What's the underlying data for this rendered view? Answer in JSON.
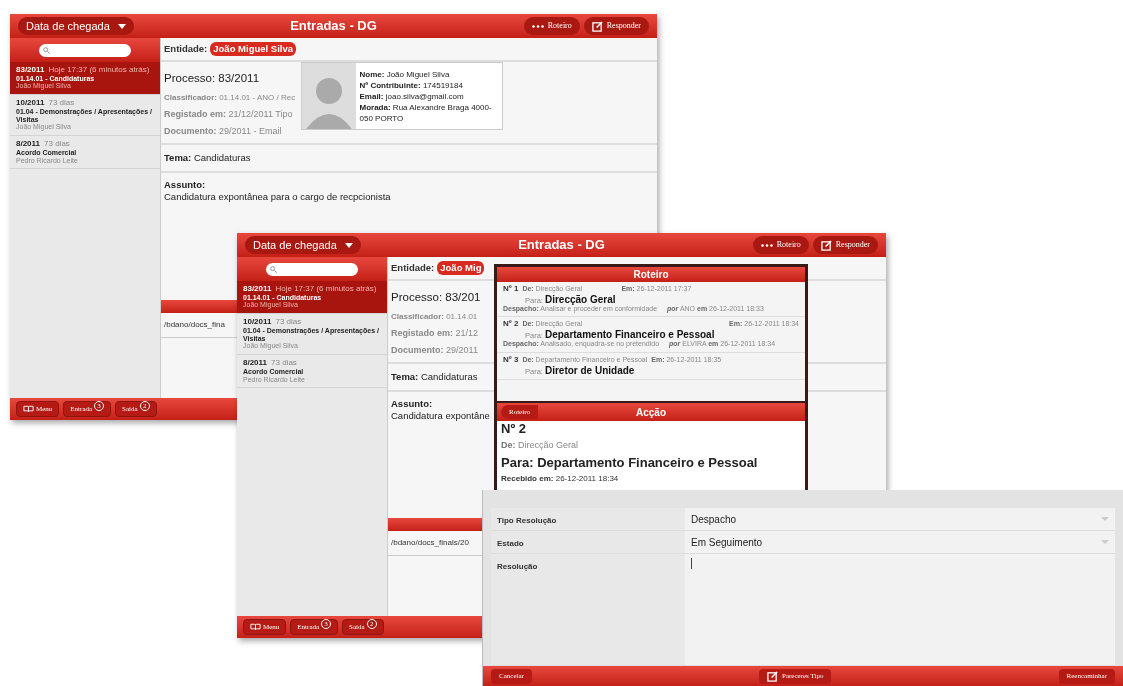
{
  "back_window": {
    "sort_button": "Data de chegada",
    "title": "Entradas - DG",
    "header_buttons": [
      "Roteiro",
      "Responder"
    ],
    "list": [
      {
        "number": "83/2011",
        "age": "Hoje 17:37 (6 minutos atrás)",
        "category": "01.14.01 - Candidaturas",
        "entity": "João Miguel Silva",
        "selected": true
      },
      {
        "number": "10/2011",
        "age": "73 dias",
        "category": "01.04 - Demonstrações / Apresentações / Visitas",
        "entity": "João Miguel Silva",
        "selected": false
      },
      {
        "number": "8/2011",
        "age": "73 dias",
        "category": "Acordo Comercial",
        "entity": "Pedro Ricardo Leite",
        "selected": false
      }
    ],
    "entity_label": "Entidade:",
    "entity": "João Miguel Silva",
    "process": "Processo: 83/2011",
    "fields": [
      {
        "label": "Classificador:",
        "value": "01.14.01 - ANO / Rec"
      },
      {
        "label": "Registado em:",
        "value": "21/12/2011 Tipo"
      },
      {
        "label": "Documento:",
        "value": "29/2011 - Email"
      }
    ],
    "tema": {
      "label": "Tema:",
      "value": "Candidaturas"
    },
    "assunto": {
      "label": "Assunto:",
      "value": "Candidatura expontânea para o cargo de recpcionista"
    },
    "path": "/bdano/docs_fina",
    "footer": [
      {
        "kind": "menu",
        "label": "Menu"
      },
      {
        "kind": "count",
        "label": "Entrada",
        "badge": "3"
      },
      {
        "kind": "count",
        "label": "Saída",
        "badge": "2"
      }
    ],
    "contact_card": {
      "lines": [
        {
          "label": "Nome:",
          "value": "João Miguel Silva"
        },
        {
          "label": "Nº Contribuinte:",
          "value": "174519184"
        },
        {
          "label": "Email:",
          "value": "joao.silva@gmail.com"
        },
        {
          "label": "Morada:",
          "value": "Rua Alexandre Braga 4000-050 PORTO"
        }
      ]
    }
  },
  "front_window": {
    "sort_button": "Data de chegada",
    "title": "Entradas - DG",
    "header_buttons": [
      "Roteiro",
      "Responder"
    ],
    "list": [
      {
        "number": "83/2011",
        "age": "Hoje 17:37 (6 minutos atrás)",
        "category": "01.14.01 - Candidaturas",
        "entity": "João Miguel Silva",
        "selected": true
      },
      {
        "number": "10/2011",
        "age": "73 dias",
        "category": "01.04 - Demonstrações / Apresentações / Visitas",
        "entity": "João Miguel Silva",
        "selected": false
      },
      {
        "number": "8/2011",
        "age": "73 dias",
        "category": "Acordo Comercial",
        "entity": "Pedro Ricardo Leite",
        "selected": false
      }
    ],
    "entity_label": "Entidade:",
    "entity": "João Mig",
    "process": "Processo: 83/201",
    "fields": [
      {
        "label": "Classificador:",
        "value": "01.14.01"
      },
      {
        "label": "Registado em:",
        "value": "21/12"
      },
      {
        "label": "Documento:",
        "value": "29/2011"
      }
    ],
    "tema": {
      "label": "Tema:",
      "value": "Candidaturas"
    },
    "assunto": {
      "label": "Assunto:",
      "value": "Candidatura expontâne"
    },
    "path": "/bdano/docs_finals/20",
    "footer": [
      {
        "kind": "menu",
        "label": "Menu"
      },
      {
        "kind": "count",
        "label": "Entrada",
        "badge": "3"
      },
      {
        "kind": "count",
        "label": "Saída",
        "badge": "2"
      }
    ]
  },
  "roteiro": {
    "title": "Roteiro",
    "steps": [
      {
        "number": "Nº 1",
        "from_label": "De:",
        "from": "Direcção Geral",
        "at_label": "Em:",
        "at": "26-12-2011 17:37",
        "to_label": "Para:",
        "to": "Direcção Geral",
        "note_label": "Despacho:",
        "note": "Analisar e proceder em conformidade",
        "by_label": "por",
        "by": "ANO",
        "on_label": "em",
        "on": "26-12-2011 18:33"
      },
      {
        "number": "Nº 2",
        "from_label": "De:",
        "from": "Direcção Geral",
        "at_label": "Em:",
        "at": "26-12-2011 18:34",
        "to_label": "Para:",
        "to": "Departamento Financeiro e Pessoal",
        "note_label": "Despacho:",
        "note": "Analisado, enquadra-se no pretendido",
        "by_label": "por",
        "by": "ELVIRA",
        "on_label": "em",
        "on": "26-12-2011 18:34"
      },
      {
        "number": "Nº 3",
        "from_label": "De:",
        "from": "Departamento Financeiro e Pessoal",
        "at_label": "Em:",
        "at": "26-12-2011 18:35",
        "to_label": "Para:",
        "to": "Diretor de Unidade"
      }
    ]
  },
  "accao": {
    "back_button": "Roteiro",
    "title": "Acção",
    "number": "Nº 2",
    "from_label": "De:",
    "from": "Direcção Geral",
    "to": "Para: Departamento Financeiro e Pessoal",
    "received_label": "Recebido em:",
    "received": "26-12-2011 18:34"
  },
  "form": {
    "rows": [
      {
        "kind": "select",
        "label": "Tipo Resolução",
        "value": "Despacho"
      },
      {
        "kind": "select",
        "label": "Estado",
        "value": "Em Seguimento"
      },
      {
        "kind": "textarea",
        "label": "Resolução"
      }
    ],
    "buttons": [
      {
        "kind": "plain",
        "label": "Cancelar"
      },
      {
        "kind": "icon",
        "label": "Pareceres Tipo"
      },
      {
        "kind": "plain",
        "label": "Reencaminhar"
      }
    ]
  }
}
